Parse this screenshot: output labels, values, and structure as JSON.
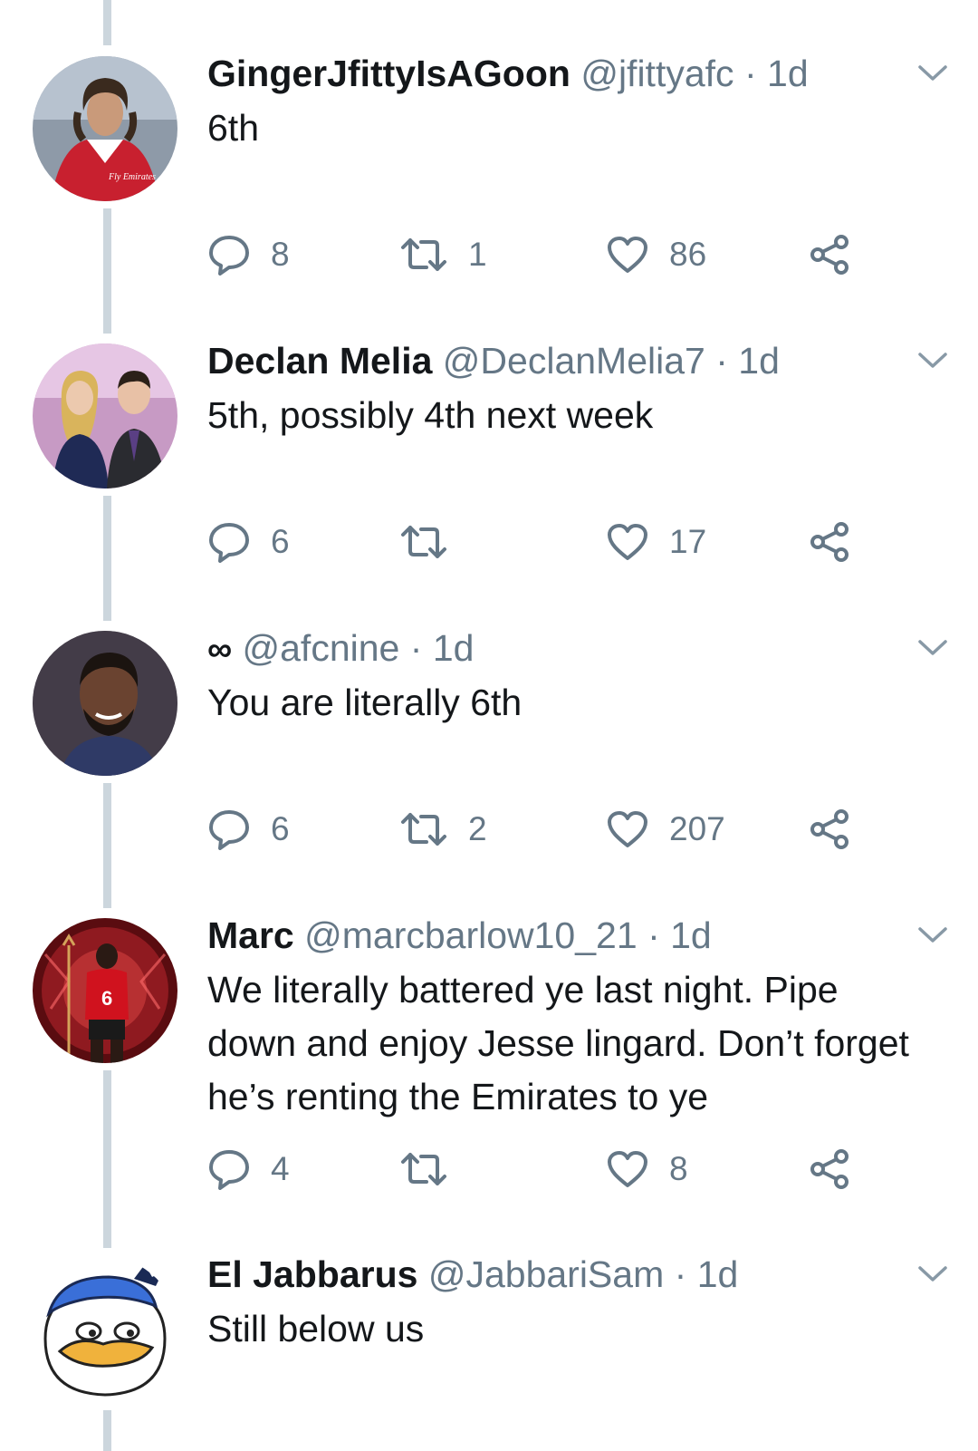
{
  "tweets": [
    {
      "name": "GingerJfittyIsAGoon",
      "handle": "@jfittyafc",
      "dot": "·",
      "time": "1d",
      "text": "6th",
      "replies": "8",
      "retweets": "1",
      "likes": "86"
    },
    {
      "name": "Declan Melia",
      "handle": "@DeclanMelia7",
      "dot": "·",
      "time": "1d",
      "text": "5th, possibly 4th next week",
      "replies": "6",
      "retweets": "",
      "likes": "17"
    },
    {
      "name": "∞",
      "handle": "@afcnine",
      "dot": "·",
      "time": "1d",
      "text": "You are literally 6th",
      "replies": "6",
      "retweets": "2",
      "likes": "207"
    },
    {
      "name": "Marc",
      "handle": "@marcbarlow10_21",
      "dot": "·",
      "time": "1d",
      "text": "We literally battered ye last night. Pipe down and enjoy Jesse lingard. Don’t forget he’s renting the Emirates to ye",
      "replies": "4",
      "retweets": "",
      "likes": "8"
    },
    {
      "name": "El Jabbarus",
      "handle": "@JabbariSam",
      "dot": "·",
      "time": "1d",
      "text": "Still below us"
    }
  ],
  "avatar_text": {
    "sponsor": "Fly Emirates",
    "shirt_number": "6"
  },
  "icons": {
    "reply": "speech-bubble-icon",
    "retweet": "retweet-arrows-icon",
    "like": "heart-icon",
    "share": "share-nodes-icon",
    "menu": "chevron-down-icon"
  },
  "colors": {
    "primary_text": "#14171a",
    "secondary_text": "#657786",
    "thread_line": "#ccd6dd"
  }
}
